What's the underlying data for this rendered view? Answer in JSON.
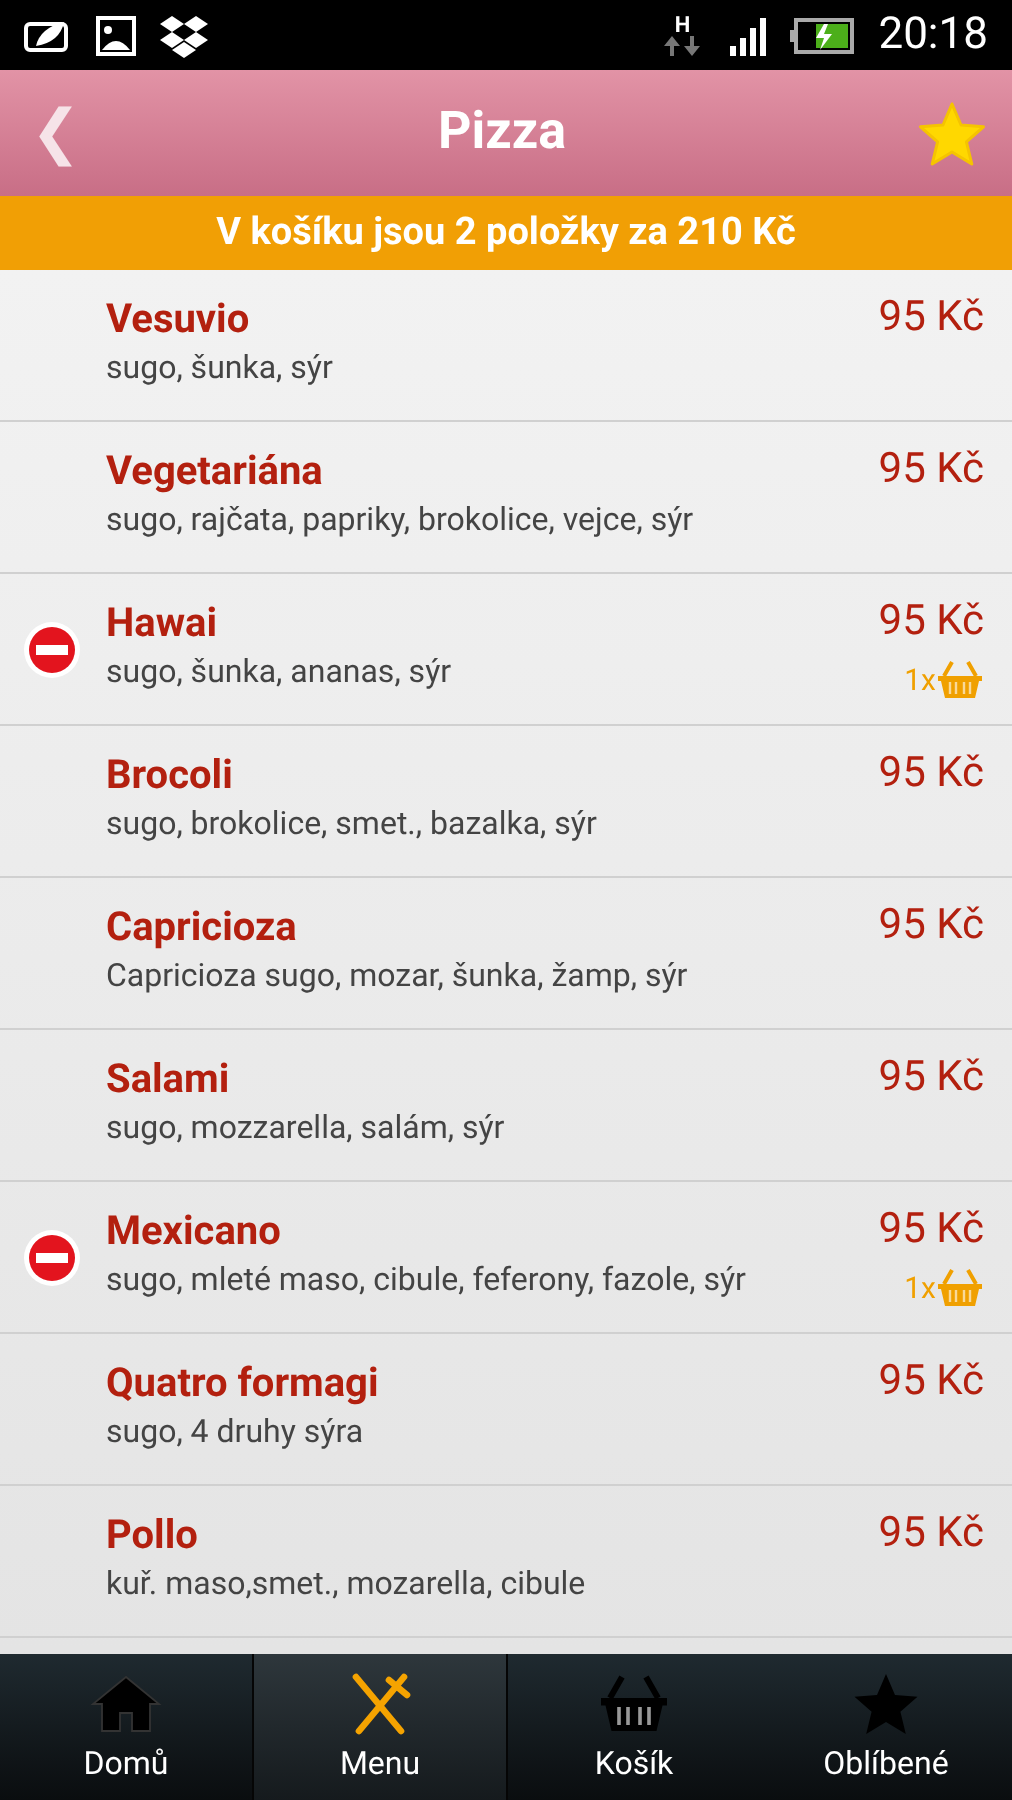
{
  "status_bar": {
    "network": "H",
    "time": "20:18"
  },
  "header": {
    "back": "❮",
    "title": "Pizza"
  },
  "cart_banner": "V košíku jsou 2 položky za 210 Kč",
  "items": [
    {
      "name": "Vesuvio",
      "ingredients": "sugo, šunka, sýr",
      "price": "95 Kč",
      "in_cart": false
    },
    {
      "name": "Vegetariána",
      "ingredients": "sugo, rajčata, papriky, brokolice, vejce, sýr",
      "price": "95 Kč",
      "in_cart": false
    },
    {
      "name": "Hawai",
      "ingredients": "sugo, šunka, ananas, sýr",
      "price": "95 Kč",
      "in_cart": true,
      "quantity": "1x"
    },
    {
      "name": "Brocoli",
      "ingredients": "sugo, brokolice, smet., bazalka, sýr",
      "price": "95 Kč",
      "in_cart": false
    },
    {
      "name": "Capricioza",
      "ingredients": "Capricioza sugo, mozar, šunka, žamp, sýr",
      "price": "95 Kč",
      "in_cart": false
    },
    {
      "name": "Salami",
      "ingredients": "sugo, mozzarella, salám, sýr",
      "price": "95 Kč",
      "in_cart": false
    },
    {
      "name": "Mexicano",
      "ingredients": "sugo, mleté maso, cibule, feferony, fazole, sýr",
      "price": "95 Kč",
      "in_cart": true,
      "quantity": "1x"
    },
    {
      "name": "Quatro formagi",
      "ingredients": "sugo, 4 druhy sýra",
      "price": "95 Kč",
      "in_cart": false
    },
    {
      "name": "Pollo",
      "ingredients": "kuř. maso,smet., mozarella, cibule",
      "price": "95 Kč",
      "in_cart": false
    }
  ],
  "tabs": [
    {
      "kind": "home",
      "label": "Domů",
      "selected": false
    },
    {
      "kind": "menu",
      "label": "Menu",
      "selected": true
    },
    {
      "kind": "basket",
      "label": "Košík",
      "selected": false
    },
    {
      "kind": "favorites",
      "label": "Oblíbené",
      "selected": false
    }
  ]
}
